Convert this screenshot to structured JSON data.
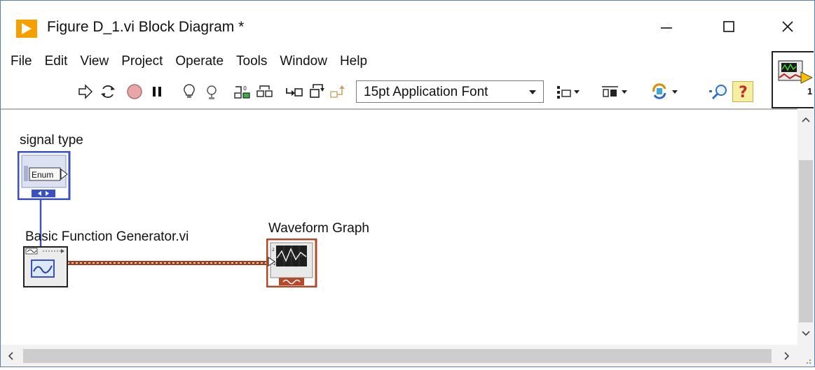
{
  "window": {
    "title": "Figure D_1.vi Block Diagram *"
  },
  "menu": {
    "items": [
      "File",
      "Edit",
      "View",
      "Project",
      "Operate",
      "Tools",
      "Window",
      "Help"
    ]
  },
  "toolbar": {
    "font_select": "15pt Application Font",
    "icons": [
      "run-arrow-icon",
      "run-continuously-icon",
      "abort-icon",
      "pause-icon",
      "highlight-execution-icon",
      "retain-wire-values-icon",
      "step-into-icon",
      "step-over-icon",
      "step-out-icon",
      "align-objects-icon",
      "distribute-objects-icon",
      "reorder-icon",
      "search-icon",
      "context-help-icon"
    ]
  },
  "vi_icon": {
    "connector_number": "1"
  },
  "diagram": {
    "signal_type_label": "signal type",
    "enum_text": "Enum",
    "generator_label": "Basic Function Generator.vi",
    "graph_label": "Waveform Graph"
  },
  "colors": {
    "enum_wire": "#3a4fc8",
    "waveform_wire": "#a03c1e",
    "graph_terminal": "#b24a2a",
    "window_border": "#5a7fb8"
  }
}
